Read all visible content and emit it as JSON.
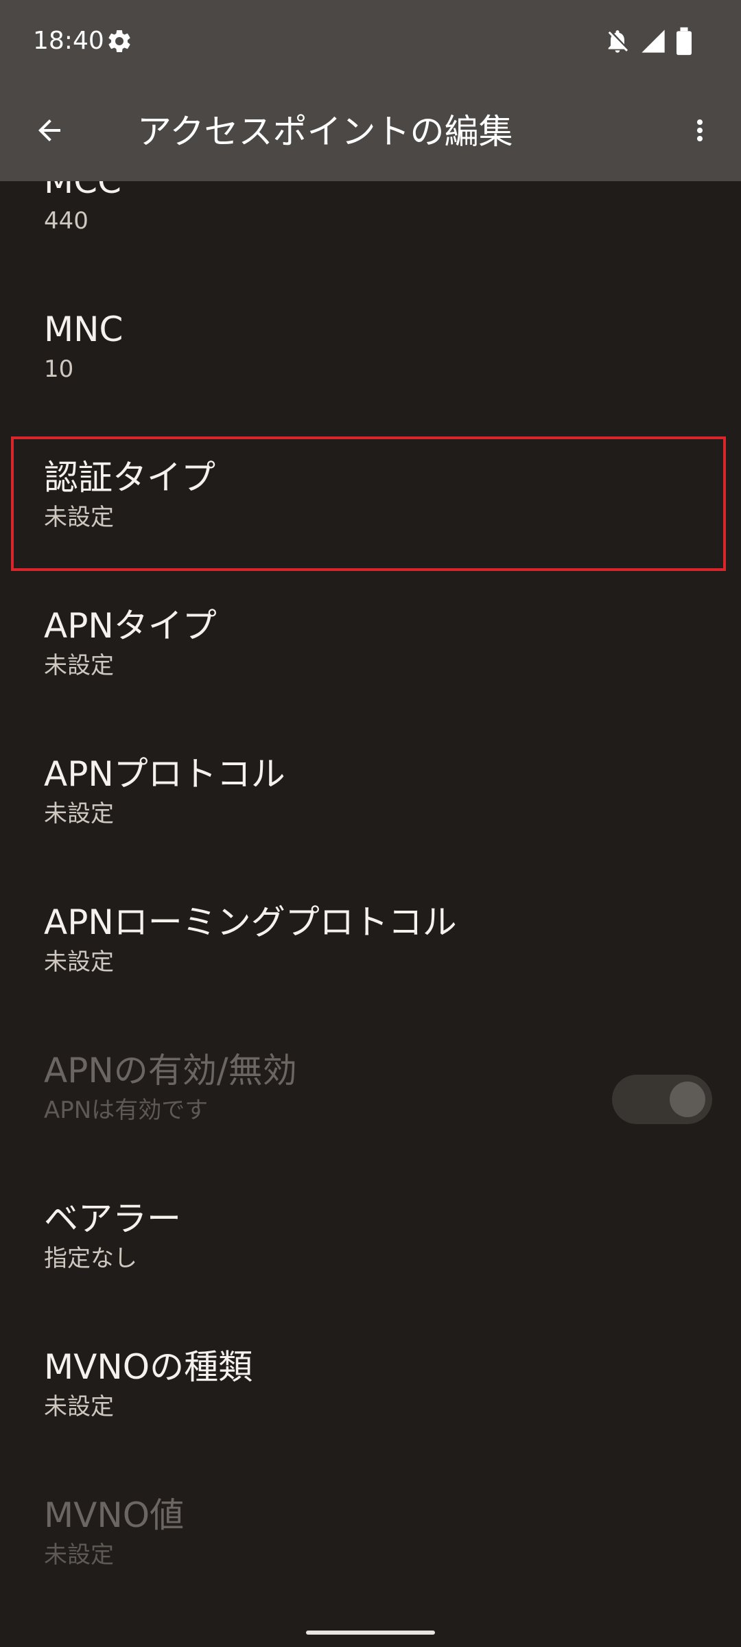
{
  "status_bar": {
    "time": "18:40",
    "icons": [
      "settings-gear-icon",
      "notifications-off-icon",
      "cell-signal-icon",
      "battery-icon"
    ]
  },
  "app_bar": {
    "title": "アクセスポイントの編集",
    "back_icon": "arrow-back-icon",
    "menu_icon": "more-vert-icon"
  },
  "preferences": [
    {
      "id": "mcc",
      "title": "MCC",
      "summary": "440",
      "enabled": true
    },
    {
      "id": "mnc",
      "title": "MNC",
      "summary": "10",
      "enabled": true
    },
    {
      "id": "auth-type",
      "title": "認証タイプ",
      "summary": "未設定",
      "enabled": true,
      "highlighted": true
    },
    {
      "id": "apn-type",
      "title": "APNタイプ",
      "summary": "未設定",
      "enabled": true
    },
    {
      "id": "apn-protocol",
      "title": "APNプロトコル",
      "summary": "未設定",
      "enabled": true
    },
    {
      "id": "apn-roaming-protocol",
      "title": "APNローミングプロトコル",
      "summary": "未設定",
      "enabled": true
    },
    {
      "id": "apn-enable",
      "title": "APNの有効/無効",
      "summary": "APNは有効です",
      "enabled": false,
      "toggle_on": true
    },
    {
      "id": "bearer",
      "title": "ベアラー",
      "summary": "指定なし",
      "enabled": true
    },
    {
      "id": "mvno-type",
      "title": "MVNOの種類",
      "summary": "未設定",
      "enabled": true
    },
    {
      "id": "mvno-value",
      "title": "MVNO値",
      "summary": "未設定",
      "enabled": false
    }
  ],
  "colors": {
    "background": "#1f1c19",
    "top_bar": "#4b4845",
    "highlight_border": "#d9252b"
  }
}
